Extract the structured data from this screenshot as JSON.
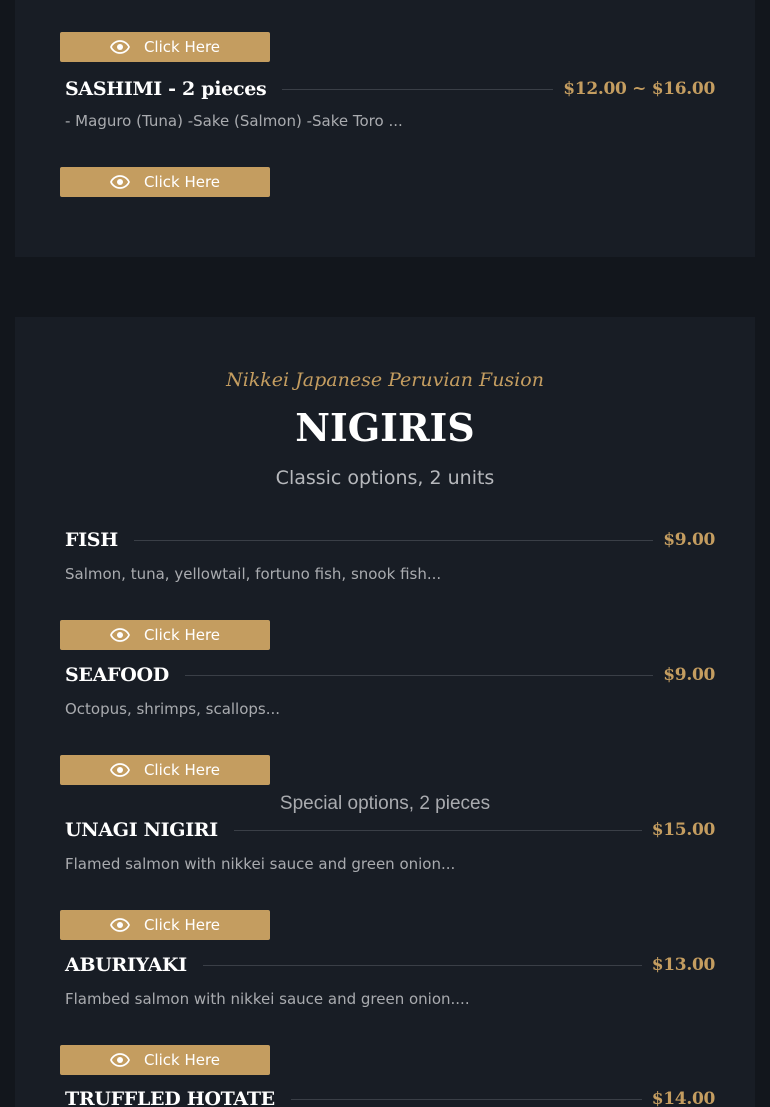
{
  "button_label": "Click Here",
  "top_section": {
    "item": {
      "name": "SASHIMI - 2 pieces",
      "price": "$12.00 ~ $16.00",
      "description": "- Maguro (Tuna) -Sake (Salmon) -Sake Toro ..."
    }
  },
  "nigiris": {
    "kicker": "Nikkei Japanese Peruvian Fusion",
    "title": "NIGIRIS",
    "subtitle": "Classic options, 2 units",
    "special_label": "Special options, 2 pieces",
    "items": [
      {
        "name": "FISH",
        "price": "$9.00",
        "description": "Salmon, tuna, yellowtail, fortuno fish, snook fish..."
      },
      {
        "name": "SEAFOOD",
        "price": "$9.00",
        "description": "Octopus, shrimps, scallops..."
      },
      {
        "name": "UNAGI NIGIRI",
        "price": "$15.00",
        "description": "Flamed salmon with nikkei sauce and green onion..."
      },
      {
        "name": "ABURIYAKI",
        "price": "$13.00",
        "description": "Flambed salmon with nikkei sauce and green onion...."
      },
      {
        "name": "TRUFFLED HOTATE",
        "price": "$14.00",
        "description": ""
      }
    ]
  },
  "colors": {
    "page_background": "#12161c",
    "card_background": "#181d25",
    "accent_gold": "#c49d60",
    "text_primary": "#ffffff",
    "text_muted": "#a9abaf"
  },
  "icons": {
    "button_icon": "eye-icon"
  }
}
